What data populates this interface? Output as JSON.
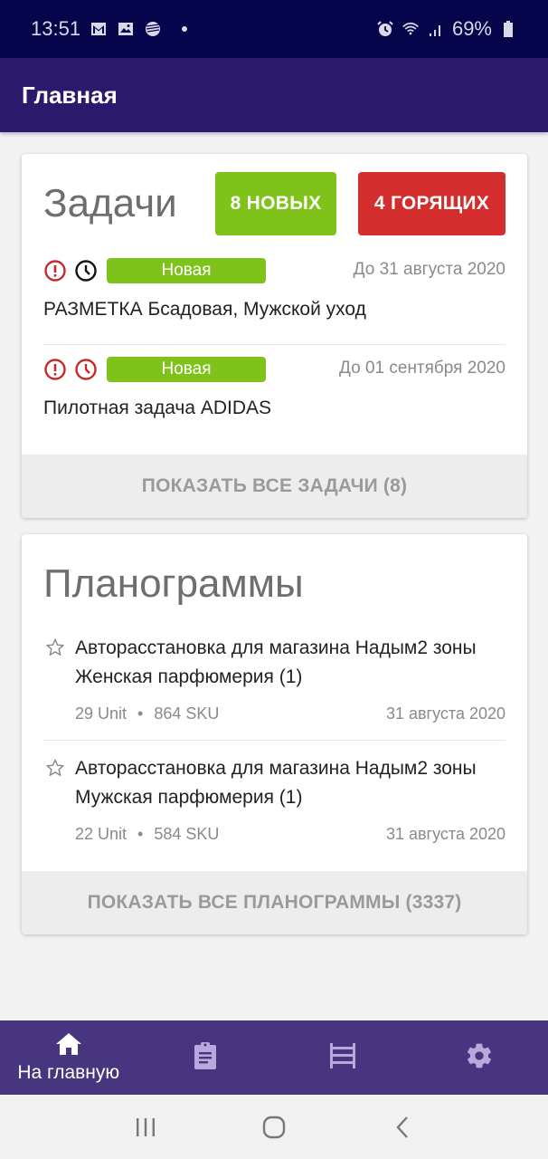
{
  "status_bar": {
    "time": "13:51",
    "left_icons": [
      "gmail-icon",
      "gallery-icon",
      "sberbank-icon",
      "notification-dot"
    ],
    "right_icons": [
      "alarm-icon",
      "wifi-icon",
      "signal-icon"
    ],
    "battery": "69%"
  },
  "app_bar": {
    "title": "Главная"
  },
  "tasks_card": {
    "title": "Задачи",
    "new_button": "8 НОВЫХ",
    "hot_button": "4 ГОРЯЩИХ",
    "colors": {
      "new": "#7fc31a",
      "hot": "#d42d2d"
    },
    "items": [
      {
        "status": "Новая",
        "due": "До 31 августа 2020",
        "title": "РАЗМЕТКА Бсадовая, Мужской уход",
        "icons": [
          "alert-icon",
          "clock-icon"
        ],
        "clock_color": "#111111"
      },
      {
        "status": "Новая",
        "due": "До 01 сентября 2020",
        "title": "Пилотная задача ADIDAS",
        "icons": [
          "alert-icon",
          "clock-icon"
        ],
        "clock_color": "#c62828"
      }
    ],
    "footer": "ПОКАЗАТЬ ВСЕ ЗАДАЧИ (8)"
  },
  "planograms_card": {
    "title": "Планограммы",
    "items": [
      {
        "title": "Авторасстановка для магазина Надым2 зоны Женская парфюмерия (1)",
        "units": "29 Unit",
        "sku": "864 SKU",
        "date": "31 августа 2020"
      },
      {
        "title": "Авторасстановка для магазина Надым2 зоны Мужская парфюмерия (1)",
        "units": "22 Unit",
        "sku": "584 SKU",
        "date": "31 августа 2020"
      }
    ],
    "separator": "•",
    "footer": "ПОКАЗАТЬ ВСЕ ПЛАНОГРАММЫ (3337)"
  },
  "bottom_nav": {
    "items": [
      {
        "icon": "home-icon",
        "label": "На главную",
        "active": true
      },
      {
        "icon": "clipboard-icon",
        "label": "",
        "active": false
      },
      {
        "icon": "shelves-icon",
        "label": "",
        "active": false
      },
      {
        "icon": "settings-icon",
        "label": "",
        "active": false
      }
    ]
  },
  "system_nav": [
    "recents-button",
    "home-button",
    "back-button"
  ]
}
